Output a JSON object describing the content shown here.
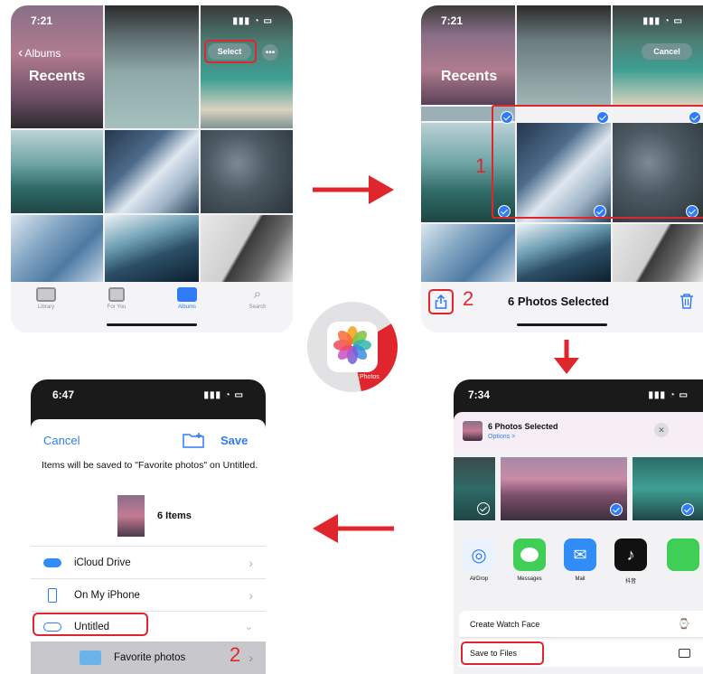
{
  "colors": {
    "accent_red": "#e0262d",
    "ios_blue": "#2f7cf6",
    "sheet_bg": "#f2f2f4"
  },
  "screen1": {
    "time": "7:21",
    "back_label": "Albums",
    "title": "Recents",
    "select_label": "Select",
    "more_icon": "ellipsis-icon",
    "tabs": [
      {
        "label": "Library",
        "icon": "library-icon"
      },
      {
        "label": "For You",
        "icon": "for-you-icon"
      },
      {
        "label": "Albums",
        "icon": "albums-icon"
      },
      {
        "label": "Search",
        "icon": "search-icon"
      }
    ]
  },
  "screen2": {
    "time": "7:21",
    "cancel_label": "Cancel",
    "title": "Recents",
    "step1": "1",
    "step2": "2",
    "selected_text": "6 Photos Selected",
    "share_icon": "share-icon",
    "trash_icon": "trash-icon"
  },
  "center_logo": {
    "label": "Photos",
    "icon": "photos-app-icon"
  },
  "screen3": {
    "time": "7:34",
    "header_title": "6 Photos Selected",
    "header_sub": "Options >",
    "close_icon": "close-icon",
    "apps": [
      {
        "label": "AirDrop",
        "icon": "airdrop-icon"
      },
      {
        "label": "Messages",
        "icon": "messages-icon"
      },
      {
        "label": "Mail",
        "icon": "mail-icon"
      },
      {
        "label": "抖音",
        "icon": "tiktok-icon"
      }
    ],
    "actions": [
      {
        "label": "Create Watch Face",
        "icon": "watch-icon"
      },
      {
        "label": "Save to Files",
        "icon": "folder-icon"
      }
    ]
  },
  "screen4": {
    "time": "6:47",
    "cancel_label": "Cancel",
    "save_label": "Save",
    "new_folder_icon": "new-folder-icon",
    "message": "Items will be saved to \"Favorite photos\" on Untitled.",
    "items_count": "6 Items",
    "locations": [
      {
        "label": "iCloud Drive",
        "icon": "icloud-icon"
      },
      {
        "label": "On My iPhone",
        "icon": "iphone-icon"
      },
      {
        "label": "Untitled",
        "icon": "drive-icon"
      }
    ],
    "folder": {
      "label": "Favorite photos",
      "icon": "folder-icon"
    },
    "step2": "2"
  }
}
